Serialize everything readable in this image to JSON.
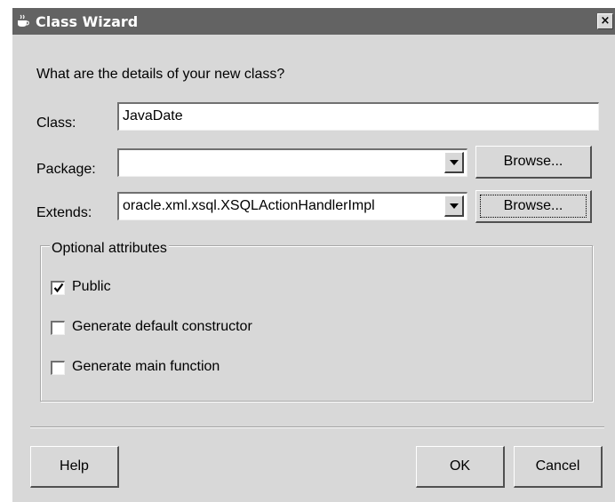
{
  "window": {
    "title": "Class Wizard",
    "close_symbol": "×"
  },
  "prompt": "What are the details of your new class?",
  "class_field": {
    "label": "Class:",
    "value": "JavaDate"
  },
  "package_field": {
    "label": "Package:",
    "value": "",
    "browse_label": "Browse..."
  },
  "extends_field": {
    "label": "Extends:",
    "value": "oracle.xml.xsql.XSQLActionHandlerImpl",
    "browse_label": "Browse..."
  },
  "optional_attributes": {
    "legend": "Optional attributes",
    "options": [
      {
        "label": "Public",
        "checked": true
      },
      {
        "label": "Generate default constructor",
        "checked": false
      },
      {
        "label": "Generate main function",
        "checked": false
      }
    ]
  },
  "buttons": {
    "help": "Help",
    "ok": "OK",
    "cancel": "Cancel"
  },
  "icons": {
    "window_icon": "coffee-cup-icon",
    "close_icon": "close-icon",
    "dropdown_icon": "dropdown-arrow-icon",
    "check_icon": "checkmark-icon"
  },
  "colors": {
    "titlebar": "#636363",
    "dialog_bg": "#d8d8d8"
  }
}
